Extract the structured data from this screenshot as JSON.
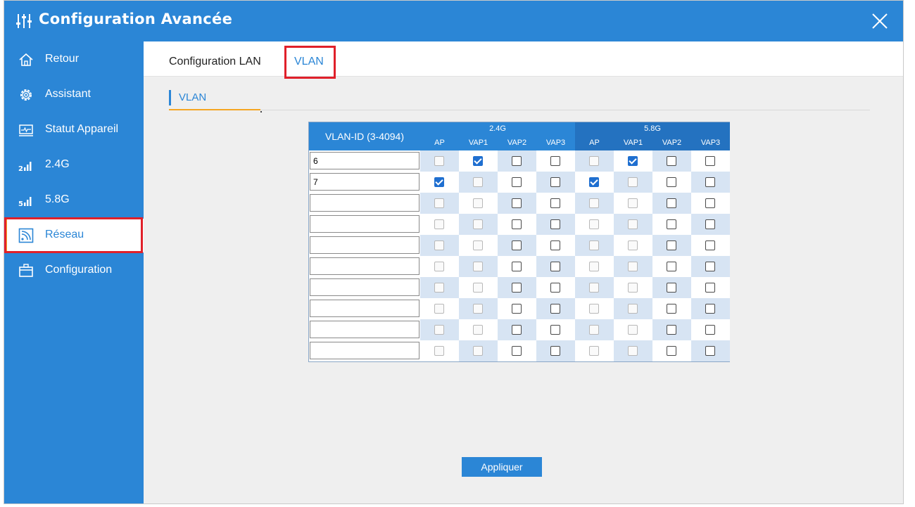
{
  "window": {
    "title": "Configuration Avancée"
  },
  "sidebar": {
    "items": [
      {
        "id": "retour",
        "label": "Retour",
        "icon": "home-icon",
        "active": false
      },
      {
        "id": "assistant",
        "label": "Assistant",
        "icon": "gear-icon",
        "active": false
      },
      {
        "id": "statut",
        "label": "Statut Appareil",
        "icon": "monitor-icon",
        "active": false
      },
      {
        "id": "24g",
        "label": "2.4G",
        "icon": "signal-2-icon",
        "active": false
      },
      {
        "id": "58g",
        "label": "5.8G",
        "icon": "signal-5-icon",
        "active": false
      },
      {
        "id": "reseau",
        "label": "Réseau",
        "icon": "network-icon",
        "active": true
      },
      {
        "id": "configuration",
        "label": "Configuration",
        "icon": "toolbox-icon",
        "active": false
      }
    ]
  },
  "tabs": [
    {
      "label": "Configuration LAN",
      "active": false
    },
    {
      "label": "VLAN",
      "active": true
    }
  ],
  "section": {
    "title": "VLAN"
  },
  "vlan_table": {
    "id_header": "VLAN-ID (3-4094)",
    "groups": [
      "2.4G",
      "5.8G"
    ],
    "columns": [
      "AP",
      "VAP1",
      "VAP2",
      "VAP3",
      "AP",
      "VAP1",
      "VAP2",
      "VAP3"
    ],
    "rows": [
      {
        "vlan_id": "6",
        "checks": [
          "disabled",
          "checked",
          "unchecked",
          "unchecked",
          "disabled",
          "checked",
          "unchecked",
          "unchecked"
        ]
      },
      {
        "vlan_id": "7",
        "checks": [
          "checked",
          "disabled",
          "unchecked",
          "unchecked",
          "checked",
          "disabled",
          "unchecked",
          "unchecked"
        ]
      },
      {
        "vlan_id": "",
        "checks": [
          "disabled",
          "disabled",
          "unchecked",
          "unchecked",
          "disabled",
          "disabled",
          "unchecked",
          "unchecked"
        ]
      },
      {
        "vlan_id": "",
        "checks": [
          "disabled",
          "disabled",
          "unchecked",
          "unchecked",
          "disabled",
          "disabled",
          "unchecked",
          "unchecked"
        ]
      },
      {
        "vlan_id": "",
        "checks": [
          "disabled",
          "disabled",
          "unchecked",
          "unchecked",
          "disabled",
          "disabled",
          "unchecked",
          "unchecked"
        ]
      },
      {
        "vlan_id": "",
        "checks": [
          "disabled",
          "disabled",
          "unchecked",
          "unchecked",
          "disabled",
          "disabled",
          "unchecked",
          "unchecked"
        ]
      },
      {
        "vlan_id": "",
        "checks": [
          "disabled",
          "disabled",
          "unchecked",
          "unchecked",
          "disabled",
          "disabled",
          "unchecked",
          "unchecked"
        ]
      },
      {
        "vlan_id": "",
        "checks": [
          "disabled",
          "disabled",
          "unchecked",
          "unchecked",
          "disabled",
          "disabled",
          "unchecked",
          "unchecked"
        ]
      },
      {
        "vlan_id": "",
        "checks": [
          "disabled",
          "disabled",
          "unchecked",
          "unchecked",
          "disabled",
          "disabled",
          "unchecked",
          "unchecked"
        ]
      },
      {
        "vlan_id": "",
        "checks": [
          "disabled",
          "disabled",
          "unchecked",
          "unchecked",
          "disabled",
          "disabled",
          "unchecked",
          "unchecked"
        ]
      }
    ]
  },
  "buttons": {
    "apply": "Appliquer"
  },
  "colors": {
    "brand": "#2b86d6",
    "accent": "#f5a623",
    "highlight": "#e0202a",
    "checked": "#1f6fd0"
  }
}
